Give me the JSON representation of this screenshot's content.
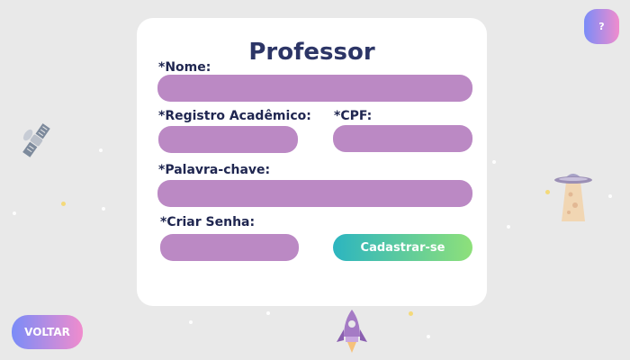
{
  "form": {
    "title": "Professor",
    "nome_label": "*Nome:",
    "registro_label": "*Registro Acadêmico:",
    "cpf_label": "*CPF:",
    "palavra_label": "*Palavra-chave:",
    "senha_label": "*Criar Senha:",
    "nome_value": "",
    "registro_value": "",
    "cpf_value": "",
    "palavra_value": "",
    "senha_value": "",
    "submit_label": "Cadastrar-se"
  },
  "nav": {
    "back_label": "VOLTAR",
    "help_label": "?"
  },
  "colors": {
    "field": "#bb89c4",
    "title": "#2c3566",
    "submit_gradient": [
      "#2cb5c0",
      "#8ee07a"
    ],
    "nav_gradient": [
      "#7a8cf8",
      "#f08ccd"
    ]
  },
  "icons": [
    "satellite-icon",
    "ufo-icon",
    "rocket-icon"
  ]
}
